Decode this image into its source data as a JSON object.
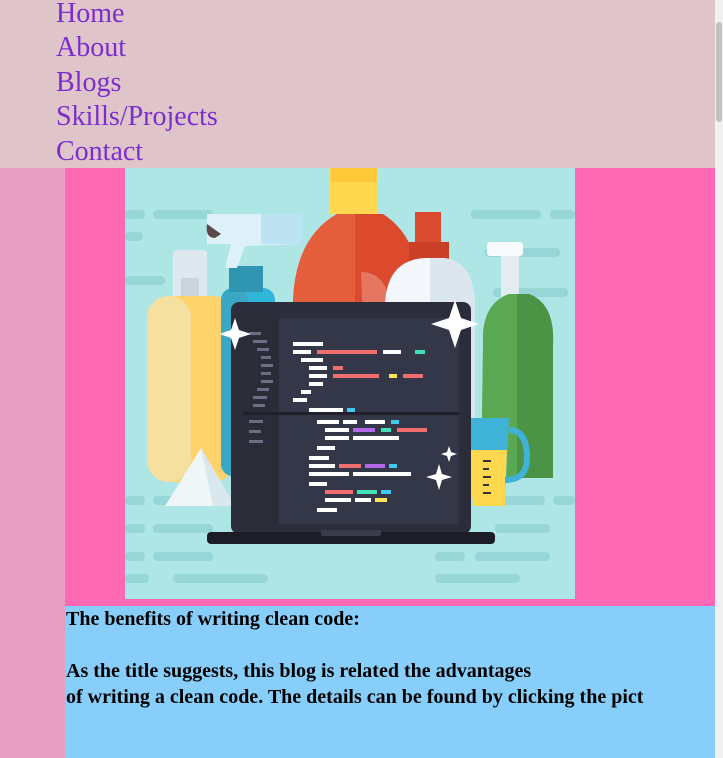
{
  "nav": {
    "items": [
      {
        "label": "Home"
      },
      {
        "label": "About"
      },
      {
        "label": "Blogs"
      },
      {
        "label": "Skills/Projects"
      },
      {
        "label": "Contact"
      }
    ]
  },
  "blog": {
    "image_icon": "clean-code-illustration",
    "title": "The benefits of writing clean code:",
    "text_line1": "As the title suggests, this blog is related the advantages",
    "text_line2": "of writing a clean code. The details can be found by clicking the pict"
  },
  "colors": {
    "nav_bg": "#dfc5c9",
    "link": "#7b2ecd",
    "left_strip": "#e69ec3",
    "pink_panel": "#ff69b4",
    "blue_panel": "#87cefa",
    "illustration_bg": "#ade6e5"
  }
}
